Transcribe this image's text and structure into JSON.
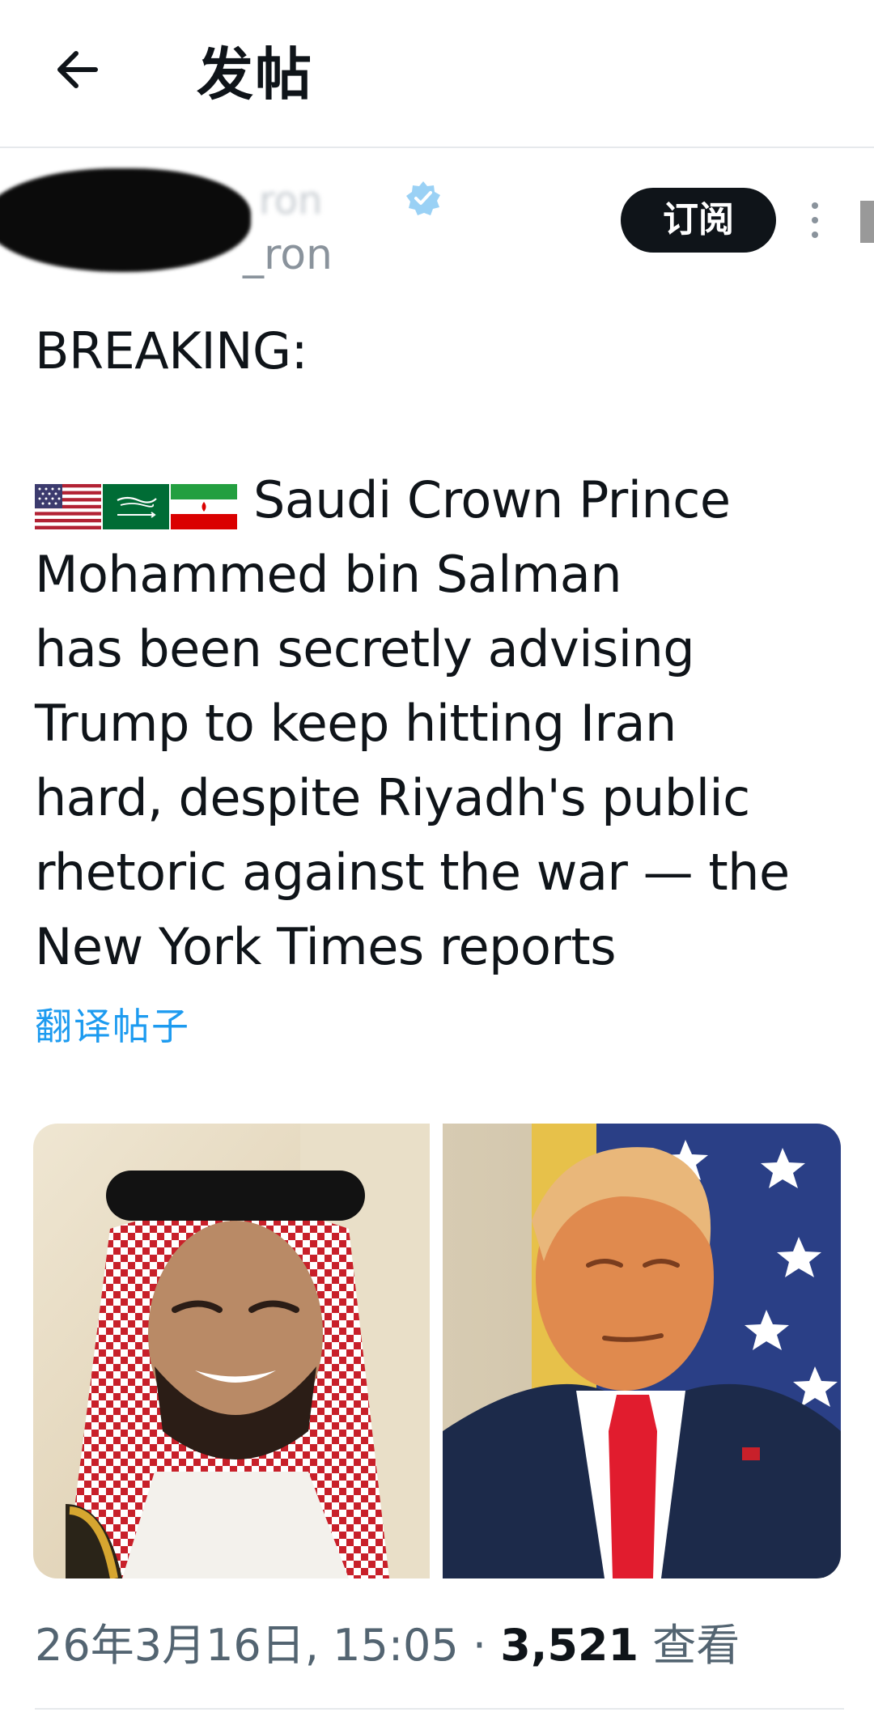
{
  "header": {
    "title": "发帖"
  },
  "author": {
    "display_name": "ron",
    "handle": "_ron",
    "subscribe_label": "订阅"
  },
  "tweet": {
    "lines": [
      "BREAKING:",
      "",
      "Saudi Crown Prince",
      "Mohammed bin Salman",
      "has been secretly advising",
      "Trump to keep hitting Iran",
      "hard, despite Riyadh's public",
      "rhetoric against the war — the",
      "New York Times reports"
    ],
    "flags": [
      "us-flag-icon",
      "saudi-flag-icon",
      "iran-flag-icon"
    ],
    "translate_label": "翻译帖子"
  },
  "meta": {
    "date": "26年3月16日, 15:05",
    "separator": "·",
    "views": "3,521",
    "views_label": "查看"
  },
  "colors": {
    "link": "#1d9bf0",
    "text": "#0f1419",
    "secondary": "#536471"
  }
}
